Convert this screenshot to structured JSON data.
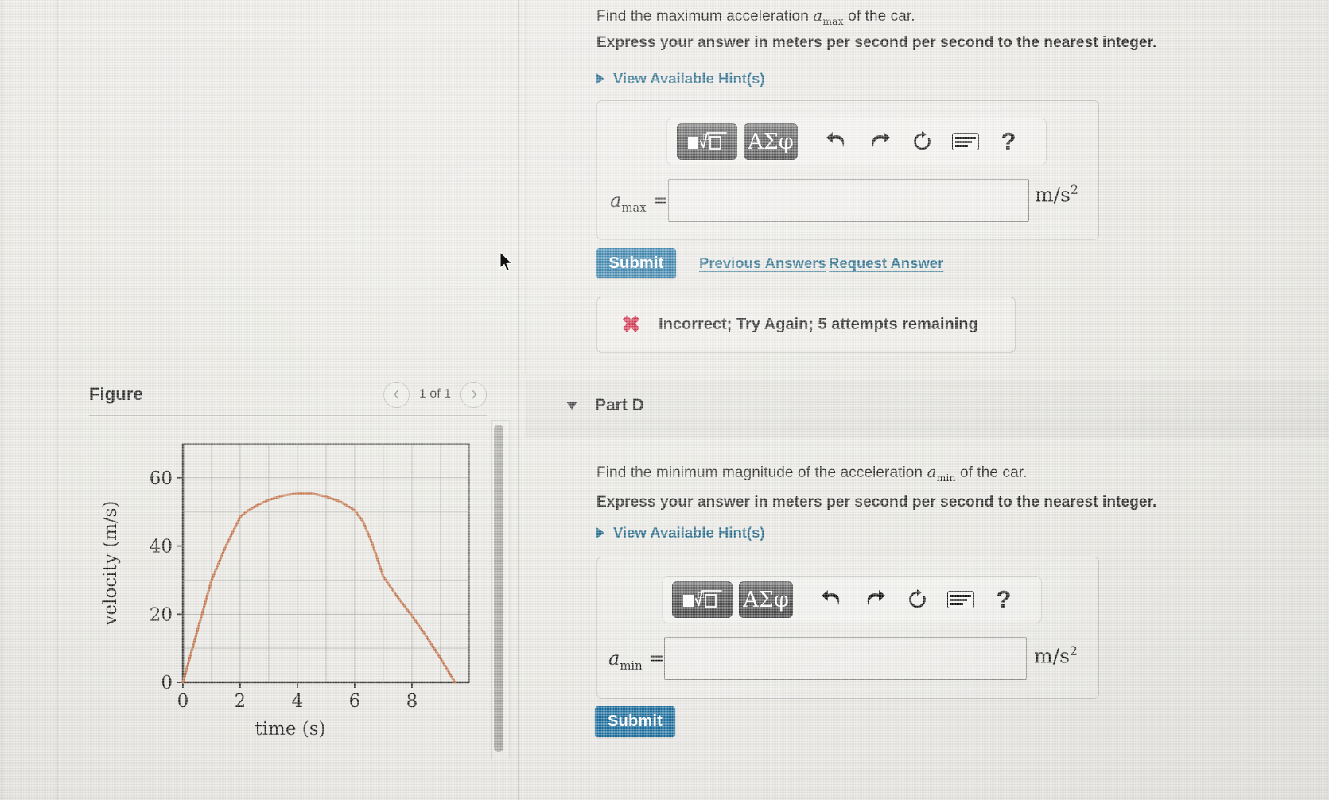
{
  "figure": {
    "title": "Figure",
    "page_indicator": "1 of 1",
    "prev_icon": "chevron-left-icon",
    "next_icon": "chevron-right-icon"
  },
  "chart_data": {
    "type": "line",
    "title": "",
    "xlabel": "time (s)",
    "ylabel": "velocity (m/s)",
    "xlim": [
      0,
      10
    ],
    "ylim": [
      0,
      70
    ],
    "xticks": [
      0,
      2,
      4,
      6,
      8
    ],
    "yticks": [
      0,
      20,
      40,
      60
    ],
    "xticklabels": [
      "0",
      "2",
      "4",
      "6",
      "8"
    ],
    "yticklabels": [
      "0",
      "20",
      "40",
      "60"
    ],
    "grid": true,
    "grid_x_step": 1,
    "grid_y_step": 10,
    "legend": null,
    "series": [
      {
        "name": "velocity",
        "color": "#c4744a",
        "x": [
          0,
          0.5,
          1.0,
          1.5,
          2.0,
          2.2,
          2.6,
          3.0,
          3.5,
          4.0,
          4.5,
          5.0,
          5.5,
          6.0,
          6.3,
          6.6,
          7.0,
          7.5,
          8.0,
          8.5,
          9.0,
          9.5
        ],
        "y": [
          0,
          15,
          30,
          40,
          48.5,
          50,
          52,
          53.5,
          54.8,
          55.4,
          55.4,
          54.5,
          53,
          50.5,
          47,
          41,
          31,
          25,
          19.5,
          13.5,
          7,
          0
        ]
      }
    ]
  },
  "part_c": {
    "question": "Find the maximum acceleration",
    "question_symbol_base": "a",
    "question_symbol_sub": "max",
    "question_tail": "of the car.",
    "instruction": "Express your answer in meters per second per second to the nearest integer.",
    "hints_label": "View Available Hint(s)",
    "hints_icon": "triangle-right-icon",
    "toolbar": {
      "template_button": "template-sqrt-icon",
      "greek_button": "ΑΣφ",
      "undo_icon": "undo-arrow-icon",
      "redo_icon": "redo-arrow-icon",
      "reset_icon": "refresh-circle-icon",
      "keyboard_icon": "keyboard-icon",
      "help_icon": "question-mark-icon",
      "help_label": "?"
    },
    "answer_label_base": "a",
    "answer_label_sub": "max",
    "answer_equals": "=",
    "answer_value": "",
    "answer_placeholder": "",
    "units": "m/s",
    "units_exp": "2",
    "submit_label": "Submit",
    "previous_answers_label": "Previous Answers",
    "request_answer_label": "Request Answer",
    "feedback_icon": "x-mark-icon",
    "feedback_mark": "✖",
    "feedback_text": "Incorrect; Try Again; 5 attempts remaining"
  },
  "part_d": {
    "header_label": "Part D",
    "collapse_icon": "triangle-down-icon",
    "question": "Find the minimum magnitude of the acceleration",
    "question_symbol_base": "a",
    "question_symbol_sub": "min",
    "question_tail": "of the car.",
    "instruction": "Express your answer in meters per second per second to the nearest integer.",
    "hints_label": "View Available Hint(s)",
    "hints_icon": "triangle-right-icon",
    "toolbar": {
      "template_button": "template-sqrt-icon",
      "greek_button": "ΑΣφ",
      "undo_icon": "undo-arrow-icon",
      "redo_icon": "redo-arrow-icon",
      "reset_icon": "refresh-circle-icon",
      "keyboard_icon": "keyboard-icon",
      "help_icon": "question-mark-icon",
      "help_label": "?"
    },
    "answer_label_base": "a",
    "answer_label_sub": "min",
    "answer_equals": "=",
    "answer_value": "",
    "answer_placeholder": "",
    "units": "m/s",
    "units_exp": "2",
    "submit_label": "Submit"
  },
  "colors": {
    "accent_blue": "#1a6e9e",
    "link_blue": "#1b6485",
    "error_red": "#c8102e",
    "curve": "#c4744a"
  }
}
